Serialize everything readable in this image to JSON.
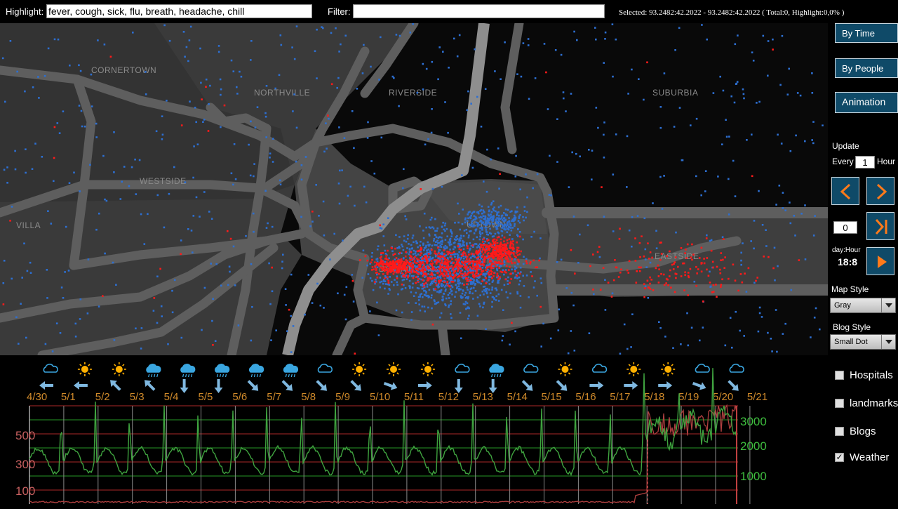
{
  "toolbar": {
    "highlight_label": "Highlight:",
    "highlight_value": "fever, cough, sick, flu, breath, headache, chill",
    "filter_label": "Filter:",
    "filter_value": "",
    "selected_info": "Selected: 93.2482:42.2022 - 93.2482:42.2022 ( Total:0, Highlight:0,0% )"
  },
  "map": {
    "district_labels": [
      "CORNERTOWN",
      "NORTHVILLE",
      "RIVERSIDE",
      "SUBURBIA",
      "WESTSIDE",
      "VILLA",
      "UPTOWN",
      "DOWNTOWN",
      "EASTSIDE"
    ],
    "colors": {
      "background": "#090909",
      "land_light": "#3a3a3a",
      "land_mid": "#2f2f2f",
      "road": "#5e5e5e",
      "river": "#8e8e8e",
      "normal_dot": "#2d6fd1",
      "highlight_dot": "#ff1a1a"
    }
  },
  "panel": {
    "by_time_label": "By Time",
    "by_people_label": "By People",
    "animation_label": "Animation",
    "update_label": "Update",
    "every_label": "Every",
    "every_value": "1",
    "hour_label": "Hour",
    "counter_value": "0",
    "dayhour_label": "day:Hour",
    "dayhour_value": "18:8",
    "map_style_label": "Map Style",
    "map_style_value": "Gray",
    "blog_style_label": "Blog Style",
    "blog_style_value": "Small Dot",
    "icons": [
      "prev-arrow-icon",
      "next-arrow-icon",
      "skip-end-icon",
      "play-icon"
    ],
    "accent_color": "#0f4a68",
    "arrow_color": "#ff7a1a"
  },
  "layers": [
    {
      "label": "Hospitals",
      "checked": false
    },
    {
      "label": "landmarks",
      "checked": false
    },
    {
      "label": "Blogs",
      "checked": false
    },
    {
      "label": "Weather",
      "checked": true
    }
  ],
  "timeline": {
    "dates": [
      "4/30",
      "5/1",
      "5/2",
      "5/3",
      "5/4",
      "5/5",
      "5/6",
      "5/7",
      "5/8",
      "5/9",
      "5/10",
      "5/11",
      "5/12",
      "5/13",
      "5/14",
      "5/15",
      "5/16",
      "5/17",
      "5/18",
      "5/19",
      "5/20",
      "5/21"
    ],
    "weather": [
      "cloud",
      "sun",
      "sun",
      "rain",
      "rain",
      "rain",
      "rain",
      "rain",
      "cloud",
      "sun",
      "sun",
      "sun",
      "cloud",
      "rain",
      "cloud",
      "sun",
      "cloud",
      "sun",
      "sun",
      "cloud",
      "cloud"
    ],
    "wind": [
      "left",
      "left",
      "up-left",
      "up-left",
      "down",
      "down",
      "down-right",
      "down-right",
      "down-right",
      "down-right",
      "right-down",
      "right",
      "down",
      "down",
      "down-right",
      "down-right",
      "right",
      "right",
      "right",
      "right-down",
      "down-right"
    ],
    "left_axis_ticks": [
      "500",
      "300",
      "100"
    ],
    "right_axis_ticks": [
      "3000",
      "2000",
      "1000"
    ],
    "colors": {
      "green_series": "#3fa33f",
      "red_series": "#b04040",
      "grid_green": "#1f7a1f",
      "grid_red": "#8a2020",
      "date_label": "#d08a2a",
      "left_axis": "#c86060",
      "right_axis": "#3fbf3f",
      "weather_icon": "#3aa6e0",
      "sun_icon": "#ffb000",
      "wind_arrow": "#7fb8e0"
    }
  }
}
